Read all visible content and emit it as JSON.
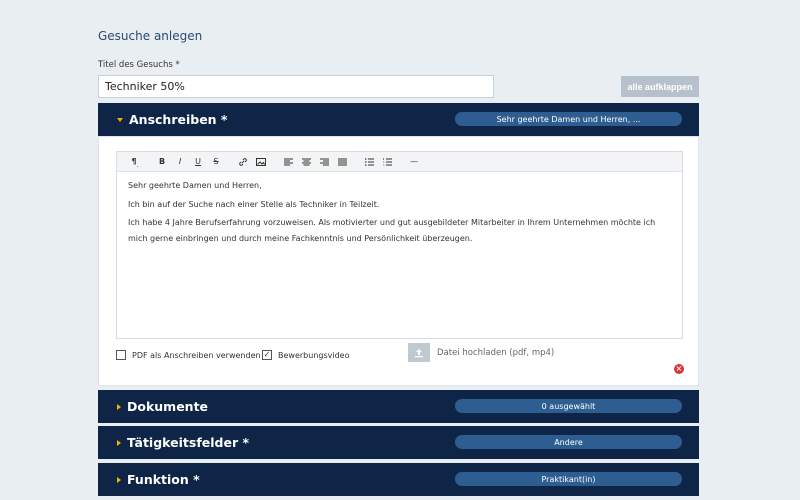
{
  "page_title": "Gesuche anlegen",
  "title_field": {
    "label": "Titel des Gesuchs *",
    "value": "Techniker 50%"
  },
  "expand_button": "alle aufklappen",
  "sections": {
    "anschreiben": {
      "title": "Anschreiben *",
      "summary": "Sehr geehrte Damen und Herren, ...",
      "expanded": true
    },
    "dokumente": {
      "title": "Dokumente",
      "summary": "0 ausgewählt"
    },
    "taetigkeitsfelder": {
      "title": "Tätigkeitsfelder *",
      "summary": "Andere"
    },
    "funktion": {
      "title": "Funktion *",
      "summary": "Praktikant(in)"
    }
  },
  "toolbar": {
    "paragraph": "¶",
    "bold": "B",
    "italic": "I",
    "underline": "U",
    "strike": "S",
    "link": "link-icon",
    "image": "image-icon",
    "align_left": "align-left-icon",
    "align_center": "align-center-icon",
    "align_right": "align-right-icon",
    "align_justify": "align-justify-icon",
    "bullet_list": "bullet-list-icon",
    "numbered_list": "numbered-list-icon",
    "horizontal_rule": "—"
  },
  "letter": {
    "p1": "Sehr geehrte Damen und Herren,",
    "p2": "Ich bin auf der Suche nach einer Stelle als Techniker in Teilzeit.",
    "p3": "Ich habe 4 Jahre Berufserfahrung vorzuweisen. Als motivierter und gut ausgebildeter Mitarbeiter in Ihrem Unternehmen möchte ich mich gerne einbringen und durch meine Fachkenntnis und Persönlichkeit überzeugen."
  },
  "options": {
    "pdf_label": "PDF als Anschreiben verwenden",
    "pdf_checked": false,
    "video_label": "Bewerbungsvideo",
    "video_checked": true,
    "check_mark": "✓"
  },
  "upload_label": "Datei hochladen (pdf, mp4)",
  "remove_symbol": "×",
  "colors": {
    "header_bg": "#0e2547",
    "pill_bg": "#2e5d91",
    "caret": "#f1b300",
    "page_bg": "#e9eef3"
  }
}
